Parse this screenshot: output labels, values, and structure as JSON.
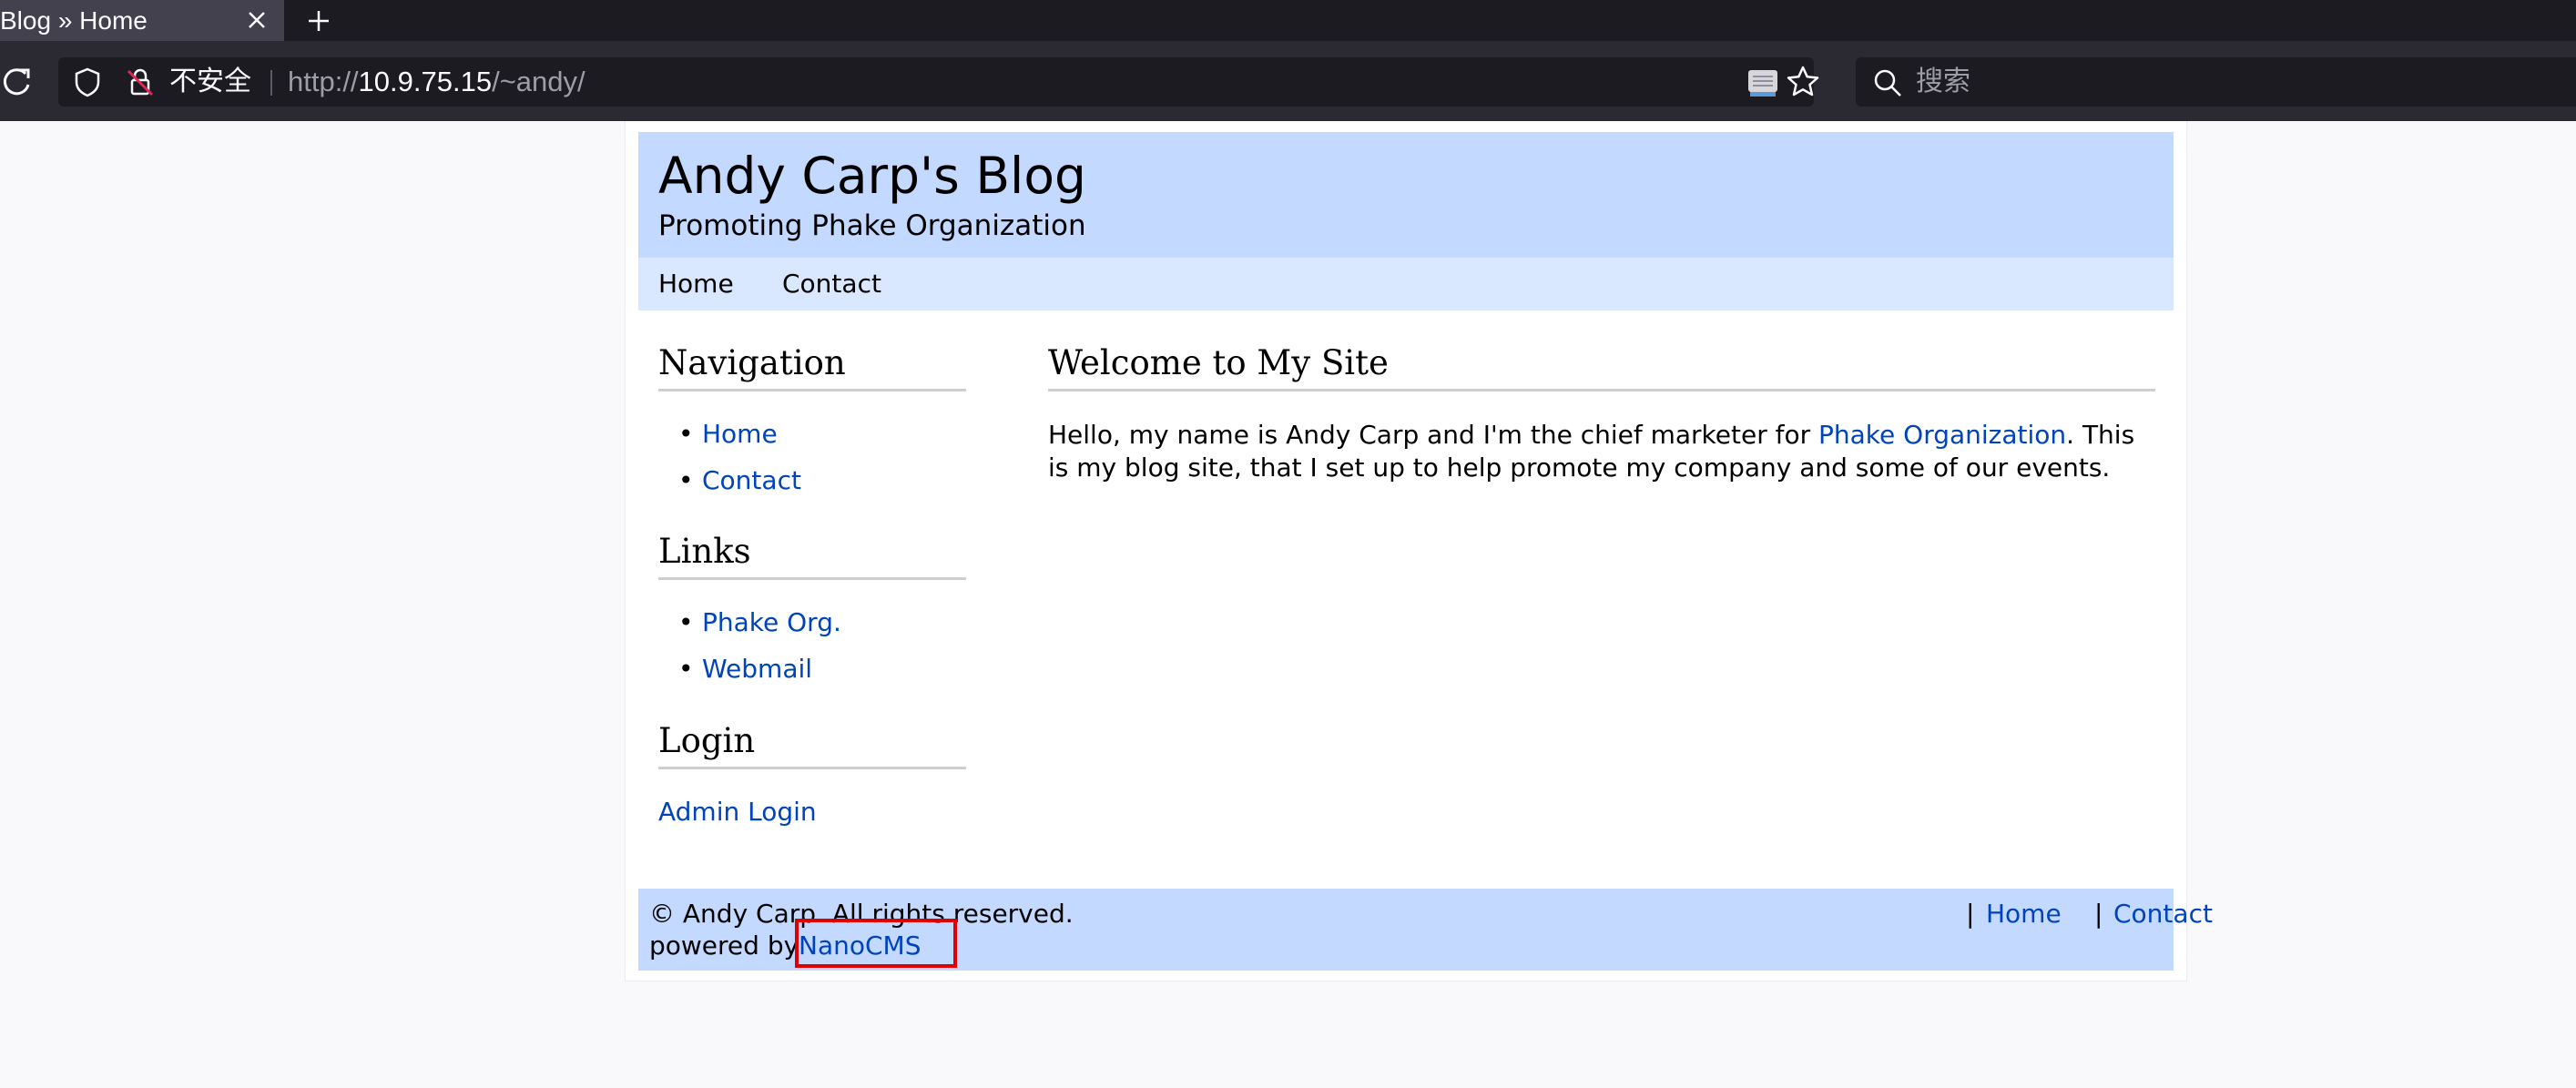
{
  "browser": {
    "tab_title": "Blog » Home",
    "insecure_label": "不安全",
    "url_scheme": "http://",
    "url_host": "10.9.75.15",
    "url_path": "/~andy/",
    "search_placeholder": "搜索"
  },
  "site": {
    "title": "Andy Carp's Blog",
    "subtitle": "Promoting Phake Organization",
    "topnav": [
      "Home",
      "Contact"
    ]
  },
  "sidebar": {
    "navigation_heading": "Navigation",
    "navigation_items": [
      "Home",
      "Contact"
    ],
    "links_heading": "Links",
    "links_items": [
      "Phake Org.",
      "Webmail"
    ],
    "login_heading": "Login",
    "login_link": "Admin Login"
  },
  "main": {
    "heading": "Welcome to My Site",
    "para_before": "Hello, my name is Andy Carp and I'm the chief marketer for ",
    "para_link": "Phake Organization",
    "para_after": ". This is my blog site, that I set up to help promote my company and some of our events."
  },
  "footer": {
    "copyright": "© Andy Carp. All rights reserved.",
    "powered_by": "powered by ",
    "powered_link": "NanoCMS",
    "sep": "|",
    "links": [
      "Home",
      "Contact"
    ]
  },
  "colors": {
    "header_bg": "#c3d9ff",
    "nav_bg": "#d9e7ff",
    "link": "#0044bb",
    "highlight": "#e00000"
  }
}
